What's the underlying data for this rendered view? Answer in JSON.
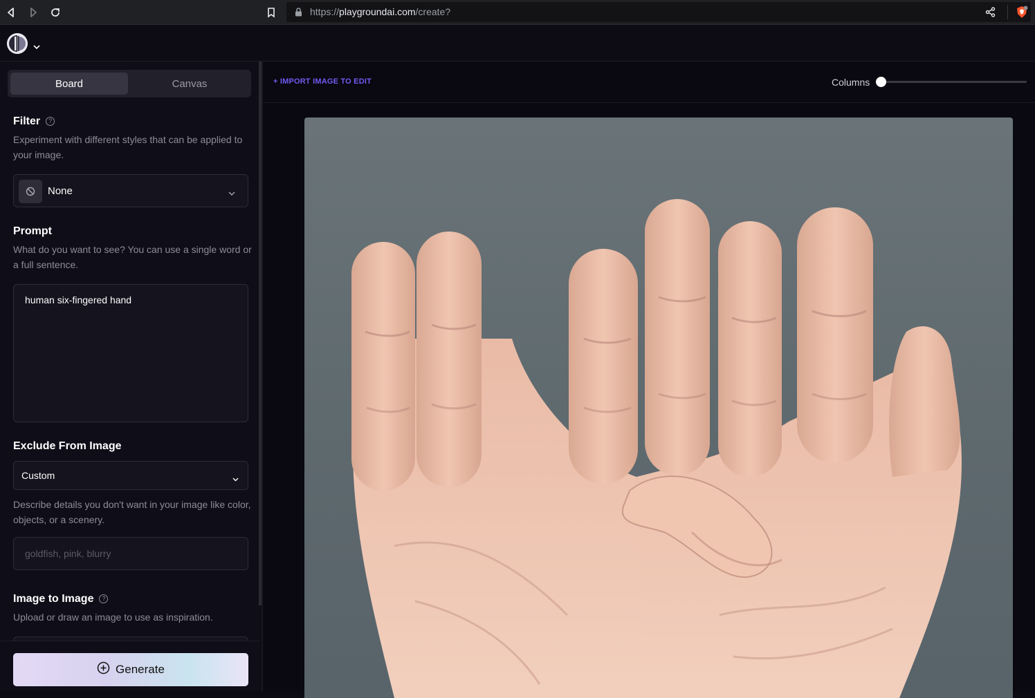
{
  "browser": {
    "url_scheme": "https://",
    "url_host": "playgroundai.com",
    "url_path": "/create?"
  },
  "sidebar": {
    "tabs": [
      {
        "label": "Board",
        "active": true
      },
      {
        "label": "Canvas",
        "active": false
      }
    ],
    "filter": {
      "title": "Filter",
      "description": "Experiment with different styles that can be applied to your image.",
      "value": "None"
    },
    "prompt": {
      "title": "Prompt",
      "description": "What do you want to see? You can use a single word or a full sentence.",
      "value": "human six-fingered hand"
    },
    "exclude": {
      "title": "Exclude From Image",
      "mode": "Custom",
      "description": "Describe details you don't want in your image like color, objects, or a scenery.",
      "placeholder": "goldfish, pink, blurry"
    },
    "image_to_image": {
      "title": "Image to Image",
      "description": "Upload or draw an image to use as inspiration."
    },
    "generate_label": "Generate"
  },
  "main": {
    "import_label": "+ IMPORT IMAGE TO EDIT",
    "columns_label": "Columns",
    "columns_value": 0
  },
  "colors": {
    "accent": "#6f5cf2",
    "background": "#0c0a13",
    "image_background": "#616b70",
    "skin": "#e8bca8"
  }
}
